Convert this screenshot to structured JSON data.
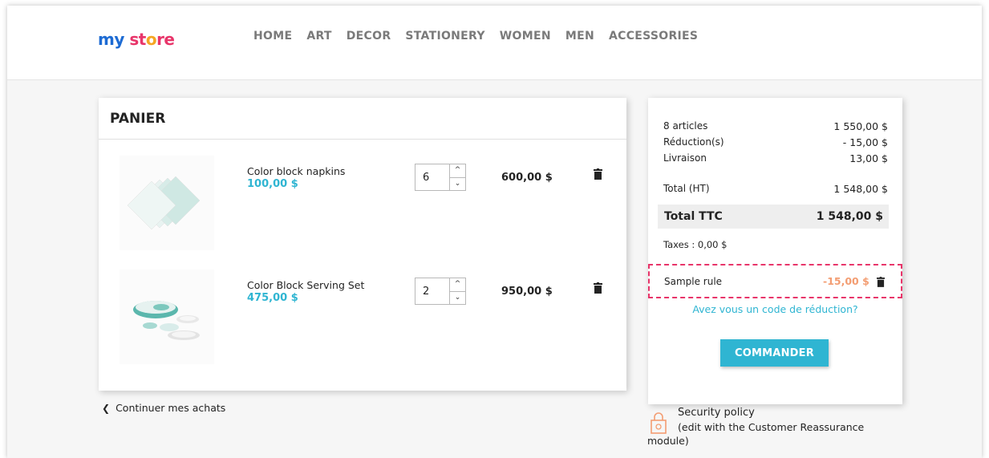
{
  "header": {
    "logo": {
      "my": "my ",
      "st": "st",
      "o": "o",
      "re": "re"
    },
    "nav": [
      "HOME",
      "ART",
      "DECOR",
      "STATIONERY",
      "WOMEN",
      "MEN",
      "ACCESSORIES"
    ]
  },
  "cart": {
    "title": "PANIER",
    "items": [
      {
        "name": "Color block napkins",
        "unit_price": "100,00 $",
        "qty": "6",
        "total": "600,00 $"
      },
      {
        "name": "Color Block Serving Set",
        "unit_price": "475,00 $",
        "qty": "2",
        "total": "950,00 $"
      }
    ],
    "continue_label": "Continuer mes achats"
  },
  "summary": {
    "articles_label": "8 articles",
    "articles_value": "1 550,00 $",
    "reduction_label": "Réduction(s)",
    "reduction_value": "- 15,00 $",
    "shipping_label": "Livraison",
    "shipping_value": "13,00 $",
    "total_ht_label": "Total (HT)",
    "total_ht_value": "1 548,00 $",
    "total_ttc_label": "Total TTC",
    "total_ttc_value": "1 548,00 $",
    "taxes": "Taxes : 0,00 $",
    "rule_name": "Sample rule",
    "rule_value": "-15,00 $",
    "promo_link": "Avez vous un code de réduction?",
    "order_button": "COMMANDER"
  },
  "reassurance": {
    "title": "Security policy",
    "subtitle": "(edit with the Customer Reassurance module)"
  },
  "colors": {
    "accent": "#2fb5d2",
    "rule_highlight": "#e8356a",
    "discount": "#f39d72"
  }
}
